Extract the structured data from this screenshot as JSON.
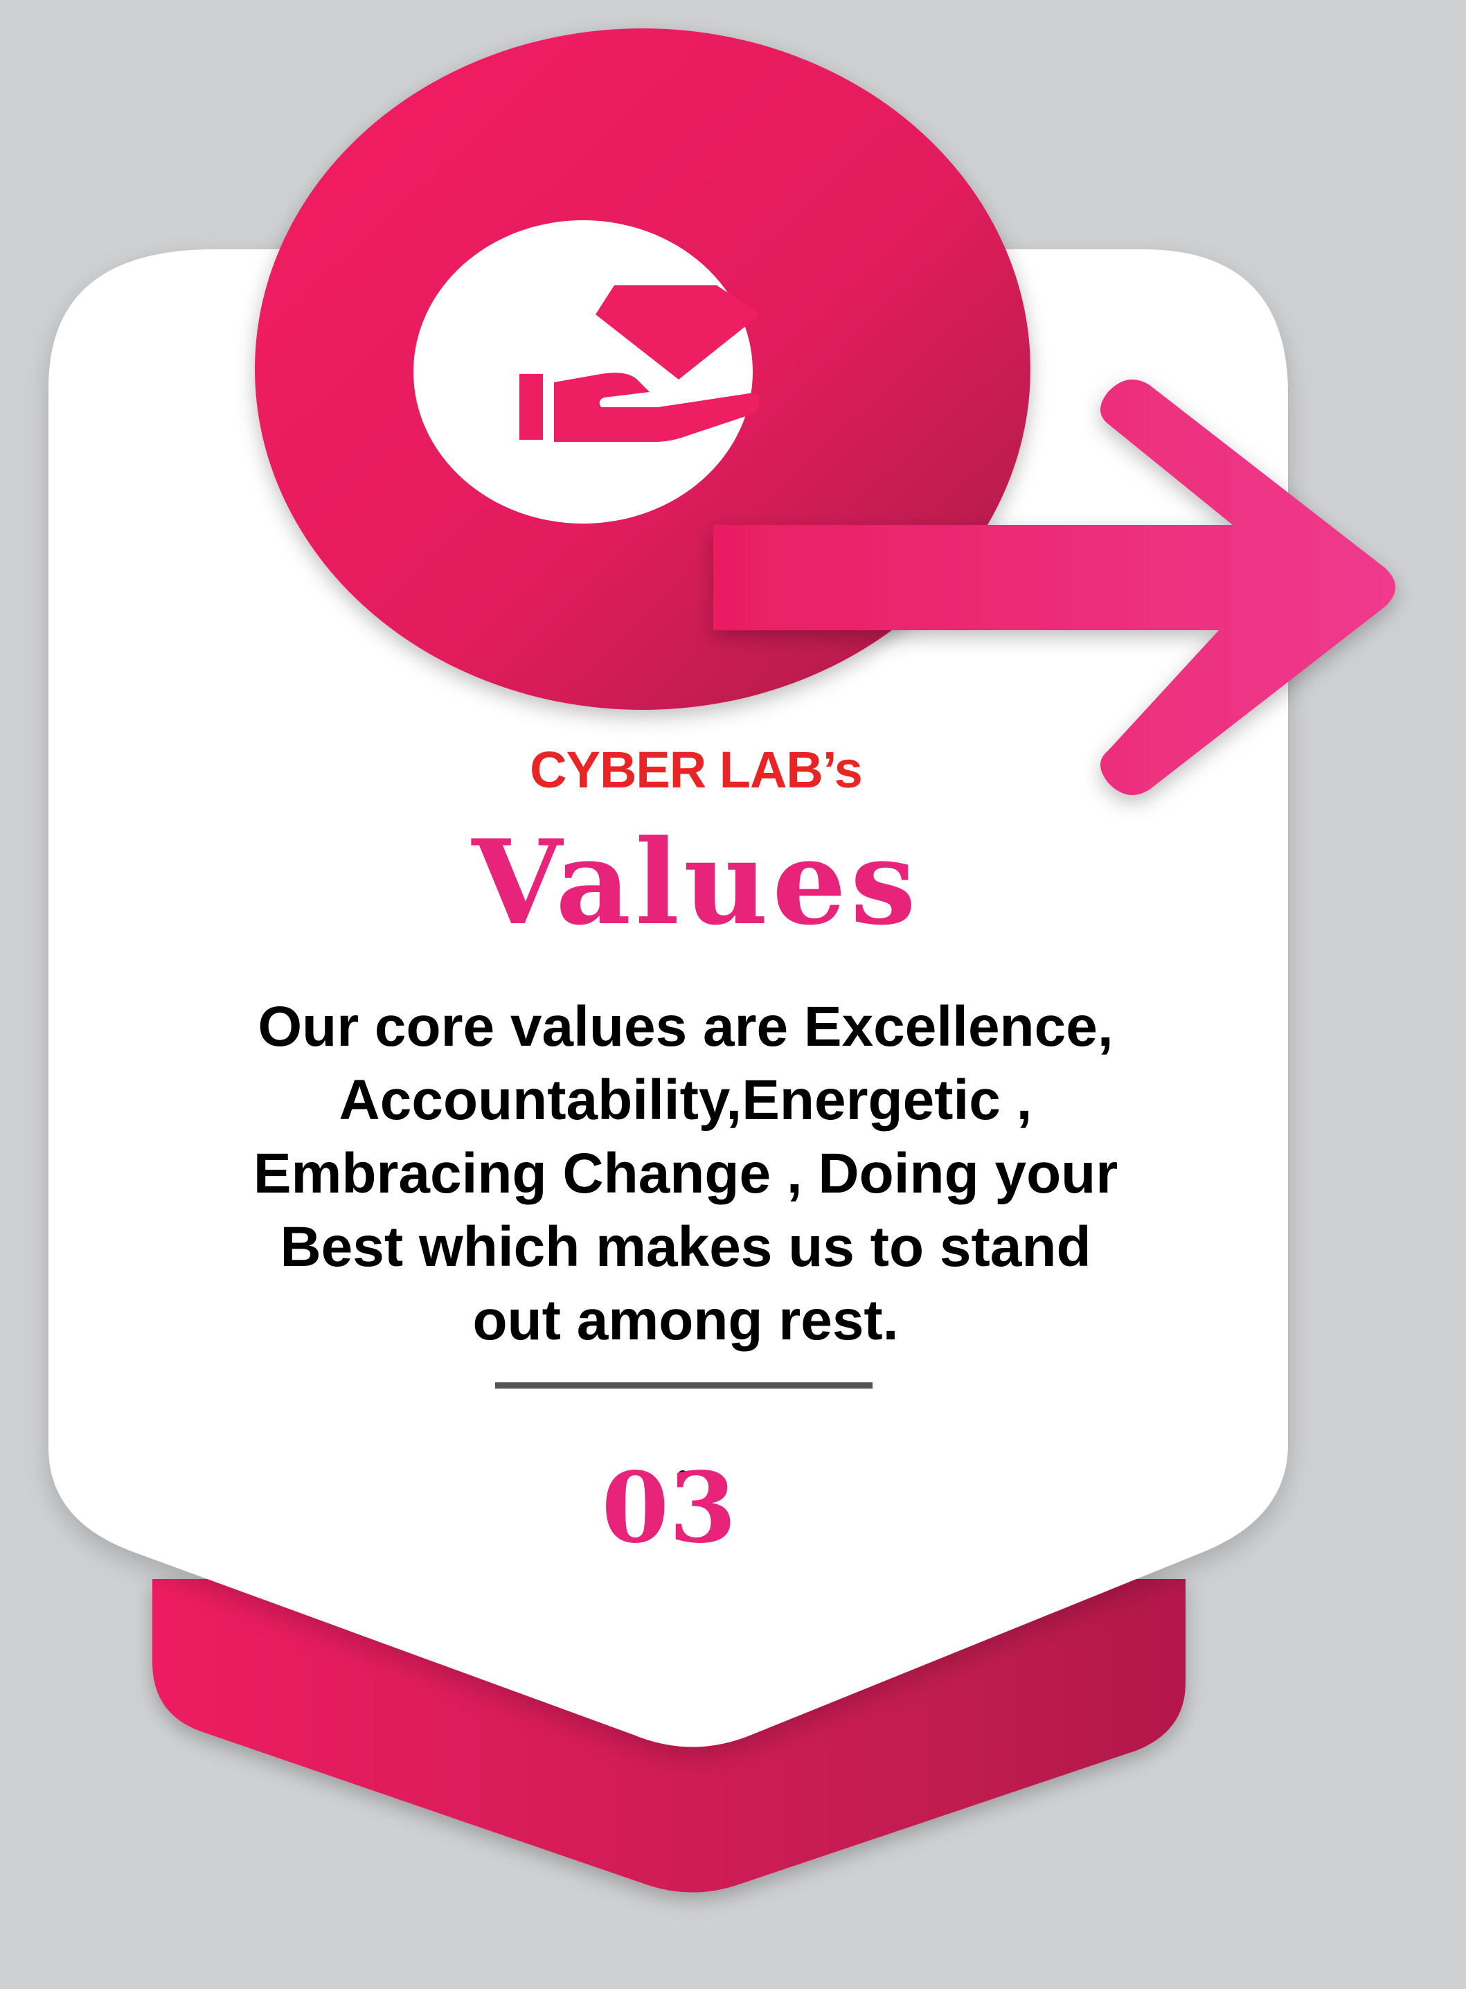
{
  "brand": "CYBER LAB’s",
  "title": "Values",
  "description": "Our  core values are Excellence,\nAccountability,Energetic ,\nEmbracing  Change ,  Doing your\nBest which makes us to stand\nout among rest.",
  "number": "03",
  "icons": {
    "badge": "hand-holding-diamond-icon",
    "arrow": "arrow-right-icon"
  },
  "colors": {
    "background": "#cfd0d2",
    "accent_pink": "#ee1e62",
    "accent_dark": "#b3174a",
    "arrow_pink": "#ee3b8d",
    "brand_red": "#e82424",
    "title_pink": "#e8237a",
    "card": "#ffffff",
    "text": "#000000",
    "divider": "#555555"
  }
}
